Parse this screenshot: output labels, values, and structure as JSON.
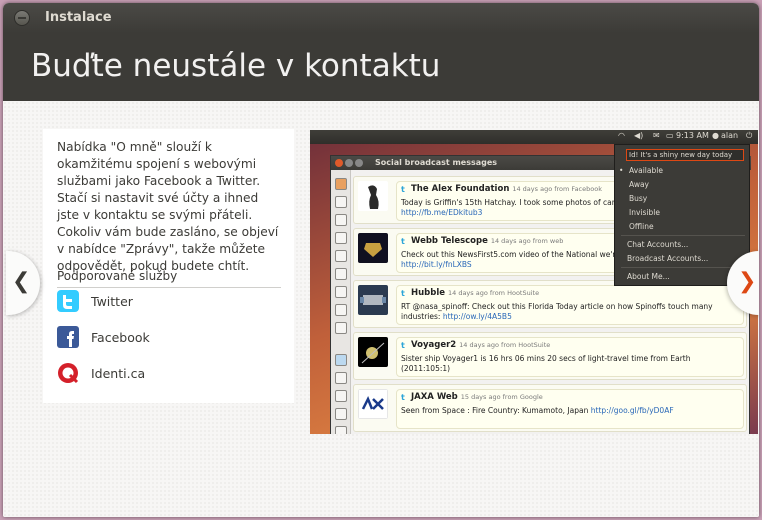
{
  "window": {
    "title": "Instalace"
  },
  "header": {
    "headline": "Buďte neustále v kontaktu"
  },
  "info": {
    "description": "Nabídka \"O mně\" slouží k okamžitému spojení s webovými službami jako Facebook a Twitter. Stačí si nastavit své účty a ihned jste v kontaktu se svými přáteli. Cokoliv vám bude zasláno, se objeví v nabídce \"Zprávy\", takže můžete odpovědět, pokud budete chtít.",
    "services_heading": "Podporované služby",
    "services": [
      {
        "name": "Twitter",
        "icon": "twitter-icon",
        "color": "#33ccff"
      },
      {
        "name": "Facebook",
        "icon": "facebook-icon",
        "color": "#3b5998"
      },
      {
        "name": "Identi.ca",
        "icon": "identica-icon",
        "color": "#d4202a"
      }
    ]
  },
  "nav": {
    "prev": "❮",
    "next": "❯"
  },
  "preview": {
    "panel": {
      "time": "9:13 AM",
      "user": "alan"
    },
    "app_title": "Social broadcast messages",
    "messages": [
      {
        "name": "The Alex Foundation",
        "meta": "14 days ago from Facebook",
        "text": "Today is Griffin's 15th Hatchay. I took some photos of cards that he received today.",
        "link": "http://fb.me/EDkitub3"
      },
      {
        "name": "Webb Telescope",
        "meta": "14 days ago from web",
        "text": "Check out this NewsFirst5.com video of the National we're covered at the beginning!",
        "link": "http://bit.ly/fnLXBS"
      },
      {
        "name": "Hubble",
        "meta": "14 days ago from HootSuite",
        "text": "RT @nasa_spinoff: Check out this Florida Today article on how Spinoffs touch many industries:",
        "link": "http://ow.ly/4A5B5"
      },
      {
        "name": "Voyager2",
        "meta": "14 days ago from HootSuite",
        "text": "Sister ship Voyager1 is 16 hrs 06 mins 20 secs of light-travel time from Earth (2011:105:1)",
        "link": ""
      },
      {
        "name": "JAXA Web",
        "meta": "15 days ago from Google",
        "text": "Seen from Space : Fire Country: Kumamoto, Japan",
        "link": "http://goo.gl/fb/yD0AF"
      }
    ],
    "menu": {
      "status_text": "Id! It's a shiny new day today",
      "statuses": [
        "Available",
        "Away",
        "Busy",
        "Invisible",
        "Offline"
      ],
      "items": [
        "Chat Accounts...",
        "Broadcast Accounts...",
        "About Me..."
      ]
    }
  }
}
